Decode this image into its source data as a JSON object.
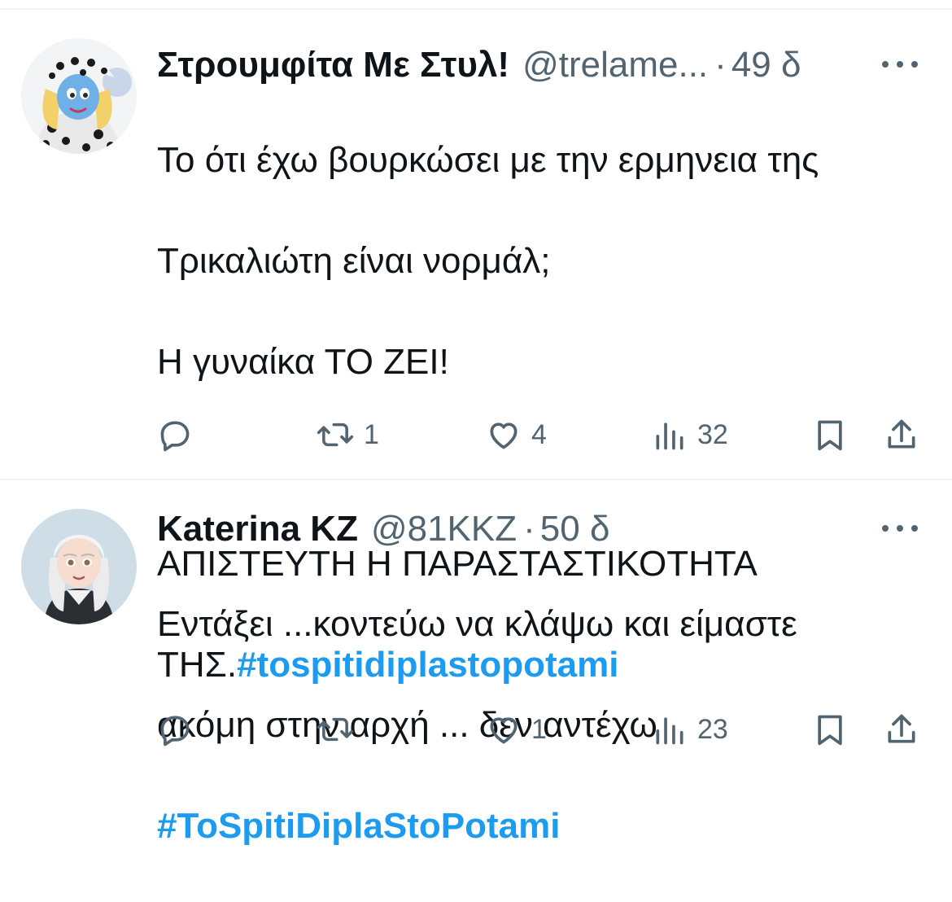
{
  "tweets": [
    {
      "name": "Στρουμφίτα Με Στυλ!",
      "handle": "@trelame...",
      "separator": "·",
      "time": "49 δ",
      "text_lines": [
        "Το ότι έχω βουρκώσει με την ερμηνεια της",
        "Τρικαλιώτη είναι νορμάλ;",
        "Η γυναίκα ΤΟ ΖΕΙ!",
        "",
        "ΑΠΙΣΤΕΥΤΗ Η ΠΑΡΑΣΤΑΣΤΙΚΟΤΗΤΑ"
      ],
      "last_line_prefix": "ΤΗΣ.",
      "hashtag": "#tospitidiplastopotami",
      "reply_count": "",
      "retweet_count": "1",
      "like_count": "4",
      "view_count": "32"
    },
    {
      "name": "Katerina KZ",
      "handle": "@81KKZ",
      "separator": "·",
      "time": "50 δ",
      "text_lines": [
        "Εντάξει ...κοντεύω να κλάψω και είμαστε",
        "ακόμη στην αρχή ... δεν αντέχω"
      ],
      "hashtag": "#ToSpitiDiplaStoPotami",
      "reply_count": "",
      "retweet_count": "",
      "like_count": "1",
      "view_count": "23"
    }
  ],
  "icons": {
    "reply": "reply-icon",
    "retweet": "retweet-icon",
    "like": "heart-icon",
    "views": "views-icon",
    "bookmark": "bookmark-icon",
    "share": "share-icon",
    "more": "more-icon"
  },
  "colors": {
    "text": "#0f1419",
    "secondary": "#536471",
    "hashtag": "#1d9bf0",
    "divider": "#eff3f4"
  }
}
